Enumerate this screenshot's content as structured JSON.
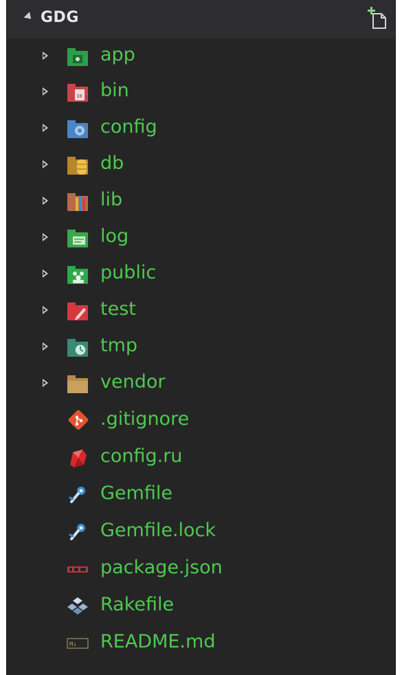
{
  "explorer": {
    "title": "GDG",
    "items": [
      {
        "label": "app",
        "icon": "folder-app-icon",
        "color": "#2e9e4a",
        "type": "folder"
      },
      {
        "label": "bin",
        "icon": "folder-binary-icon",
        "color": "#c7464a",
        "type": "folder"
      },
      {
        "label": "config",
        "icon": "folder-config-icon",
        "color": "#4a86c5",
        "type": "folder"
      },
      {
        "label": "db",
        "icon": "folder-database-icon",
        "color": "#d3a13c",
        "type": "folder"
      },
      {
        "label": "lib",
        "icon": "folder-lib-icon",
        "color": "#c46a4a",
        "type": "folder"
      },
      {
        "label": "log",
        "icon": "folder-log-icon",
        "color": "#3da84a",
        "type": "folder"
      },
      {
        "label": "public",
        "icon": "folder-public-icon",
        "color": "#2fa84a",
        "type": "folder"
      },
      {
        "label": "test",
        "icon": "folder-test-icon",
        "color": "#d3393f",
        "type": "folder"
      },
      {
        "label": "tmp",
        "icon": "folder-tmp-icon",
        "color": "#3a9a7a",
        "type": "folder"
      },
      {
        "label": "vendor",
        "icon": "folder-vendor-icon",
        "color": "#b88a4a",
        "type": "folder"
      },
      {
        "label": ".gitignore",
        "icon": "git-icon",
        "color": "#e4532f",
        "type": "file"
      },
      {
        "label": "config.ru",
        "icon": "ruby-icon",
        "color": "#d62a2a",
        "type": "file"
      },
      {
        "label": "Gemfile",
        "icon": "bundler-icon",
        "color": "#3a8fd1",
        "type": "file"
      },
      {
        "label": "Gemfile.lock",
        "icon": "bundler-icon",
        "color": "#3a8fd1",
        "type": "file"
      },
      {
        "label": "package.json",
        "icon": "npm-icon",
        "color": "#b8393a",
        "type": "file"
      },
      {
        "label": "Rakefile",
        "icon": "rake-icon",
        "color": "#9ab3d1",
        "type": "file"
      },
      {
        "label": "README.md",
        "icon": "markdown-icon",
        "color": "#8a7a5a",
        "type": "file"
      }
    ]
  }
}
